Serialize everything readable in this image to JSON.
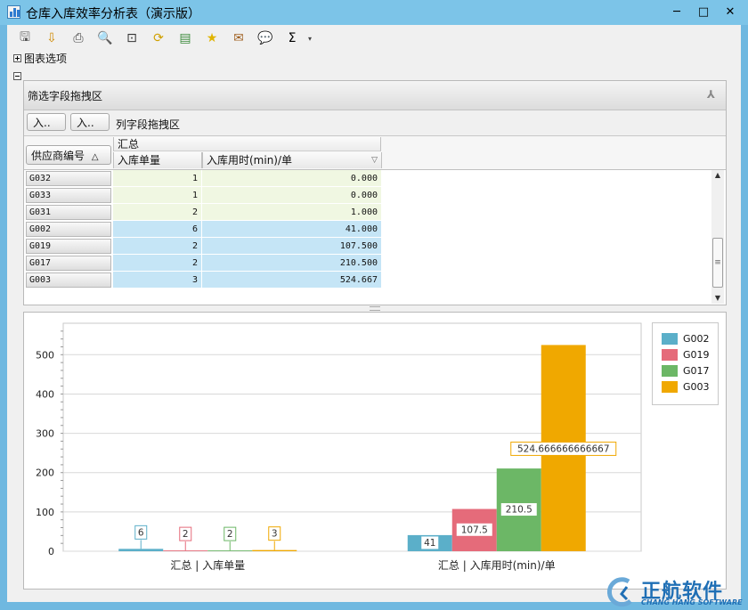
{
  "window": {
    "title": "仓库入库效率分析表（演示版）",
    "min": "─",
    "max": "□",
    "close": "✕"
  },
  "toolbar": {
    "buttons": [
      {
        "name": "save",
        "glyph": "🖫",
        "color": "#555555"
      },
      {
        "name": "export",
        "glyph": "⇩",
        "color": "#d08a00"
      },
      {
        "name": "print",
        "glyph": "⎙",
        "color": "#444444"
      },
      {
        "name": "preview",
        "glyph": "🔍",
        "color": "#4a6fa0"
      },
      {
        "name": "find",
        "glyph": "⊡",
        "color": "#333333"
      },
      {
        "name": "refresh",
        "glyph": "⟳",
        "color": "#d0a000"
      },
      {
        "name": "excel",
        "glyph": "▤",
        "color": "#3c8b3c"
      },
      {
        "name": "favorite",
        "glyph": "★",
        "color": "#e0b400"
      },
      {
        "name": "mail",
        "glyph": "✉",
        "color": "#a06020"
      },
      {
        "name": "comment",
        "glyph": "💬",
        "color": "#666666"
      },
      {
        "name": "sum",
        "glyph": "Σ",
        "color": "#000000"
      }
    ],
    "dropdown": "▾"
  },
  "options": {
    "chart_options_label": "图表选项"
  },
  "pivot": {
    "filter_area_label": "筛选字段拖拽区",
    "chart_toggle": "⅄",
    "field_btn_1": "入..",
    "field_btn_2": "入..",
    "column_area_label": "列字段拖拽区",
    "row_field": "供应商编号",
    "row_sort": "△",
    "summary_header": "汇总",
    "col1_header": "入库单量",
    "col2_header": "入库用时(min)/单",
    "col2_filter": "▽",
    "rows": [
      {
        "supplier": "G032",
        "count": "1",
        "time": "0.000",
        "style": "green"
      },
      {
        "supplier": "G033",
        "count": "1",
        "time": "0.000",
        "style": "green"
      },
      {
        "supplier": "G031",
        "count": "2",
        "time": "1.000",
        "style": "green"
      },
      {
        "supplier": "G002",
        "count": "6",
        "time": "41.000",
        "style": "blue"
      },
      {
        "supplier": "G019",
        "count": "2",
        "time": "107.500",
        "style": "blue"
      },
      {
        "supplier": "G017",
        "count": "2",
        "time": "210.500",
        "style": "blue"
      },
      {
        "supplier": "G003",
        "count": "3",
        "time": "524.667",
        "style": "blue"
      }
    ],
    "scroll_up": "▲",
    "scroll_down": "▼",
    "scroll_grip": "≡"
  },
  "chart_data": {
    "type": "bar",
    "categories": [
      "汇总 | 入库单量",
      "汇总 | 入库用时(min)/单"
    ],
    "series": [
      {
        "name": "G002",
        "color": "#5bafc9",
        "values": [
          6,
          41
        ],
        "labels": [
          "6",
          "41"
        ]
      },
      {
        "name": "G019",
        "color": "#e56b7a",
        "values": [
          2,
          107.5
        ],
        "labels": [
          "2",
          "107.5"
        ]
      },
      {
        "name": "G017",
        "color": "#6cb766",
        "values": [
          2,
          210.5
        ],
        "labels": [
          "2",
          "210.5"
        ]
      },
      {
        "name": "G003",
        "color": "#f0a800",
        "values": [
          3,
          524.666666666667
        ],
        "labels": [
          "3",
          "524.666666666667"
        ]
      }
    ],
    "ylim": [
      0,
      580
    ],
    "yticks": [
      0,
      100,
      200,
      300,
      400,
      500
    ],
    "grid": true,
    "legend": "right"
  },
  "brand": {
    "name": "正航软件",
    "sub": "CHANG HANG SOFTWARE"
  }
}
